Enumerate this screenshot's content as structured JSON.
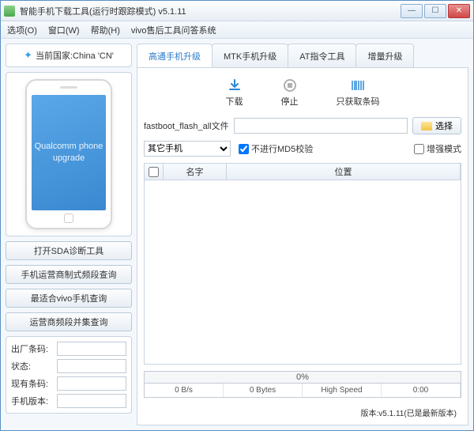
{
  "window": {
    "title": "智能手机下载工具(运行时跟踪模式)   v5.1.11"
  },
  "menu": {
    "options": "选项(O)",
    "window": "窗口(W)",
    "help": "帮助(H)",
    "vivo": "vivo售后工具问答系统"
  },
  "left": {
    "country_label": "当前国家:China 'CN'",
    "phone_text": "Qualcomm phone upgrade",
    "buttons": {
      "sda": "打开SDA诊断工具",
      "carrier": "手机运营商制式频段查询",
      "vivo_query": "最适合vivo手机查询",
      "band_query": "运营商频段并集查询"
    },
    "info": {
      "factory_code": "出厂条码:",
      "status1": "状态:",
      "current_code": "现有条码:",
      "phone_ver": "手机版本:"
    }
  },
  "tabs": {
    "qualcomm": "高通手机升级",
    "mtk": "MTK手机升级",
    "at": "AT指令工具",
    "delta": "增量升级"
  },
  "actions": {
    "download": "下载",
    "stop": "停止",
    "barcode_only": "只获取条码"
  },
  "file": {
    "label": "fastboot_flash_all文件",
    "browse": "选择"
  },
  "options": {
    "device_select": "其它手机",
    "no_md5": "不进行MD5校验",
    "enhanced": "增强模式"
  },
  "grid": {
    "name": "名字",
    "location": "位置"
  },
  "progress": {
    "percent": "0%",
    "speed": "0 B/s",
    "bytes": "0 Bytes",
    "mode": "High Speed",
    "time": "0:00"
  },
  "footer": {
    "version": "版本:v5.1.11(已是最新版本)"
  }
}
